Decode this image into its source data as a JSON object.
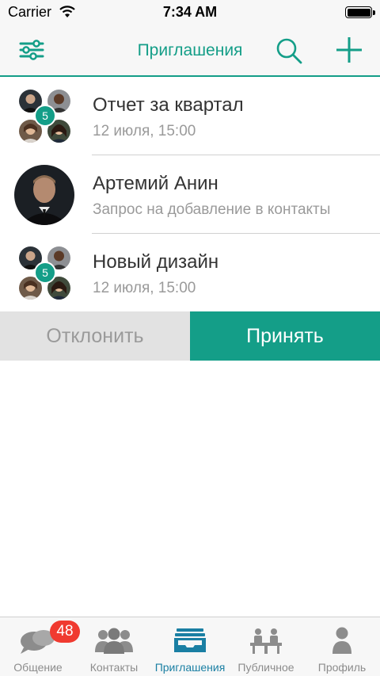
{
  "status_bar": {
    "carrier": "Carrier",
    "time": "7:34 AM"
  },
  "nav": {
    "title": "Приглашения",
    "icons": [
      "menu-sliders-icon",
      "search-icon",
      "add-icon"
    ],
    "accent_color": "#149e88"
  },
  "invitations": [
    {
      "title": "Отчет за квартал",
      "subtitle": "12 июля, 15:00",
      "type": "group",
      "member_count": "5"
    },
    {
      "title": "Артемий Анин",
      "subtitle": "Запрос на добавление в контакты",
      "type": "contact"
    },
    {
      "title": "Новый дизайн",
      "subtitle": "12 июля, 15:00",
      "type": "group",
      "member_count": "5"
    }
  ],
  "actions": {
    "decline_label": "Отклонить",
    "accept_label": "Принять"
  },
  "tabbar": {
    "tabs": [
      {
        "label": "Общение",
        "icon": "chat-bubbles-icon",
        "badge": "48"
      },
      {
        "label": "Контакты",
        "icon": "people-icon"
      },
      {
        "label": "Приглашения",
        "icon": "inbox-tray-icon",
        "active": true
      },
      {
        "label": "Публичное",
        "icon": "meeting-table-icon"
      },
      {
        "label": "Профиль",
        "icon": "person-icon"
      }
    ],
    "active_color": "#1a7fa3",
    "badge_color": "#f03a30"
  }
}
